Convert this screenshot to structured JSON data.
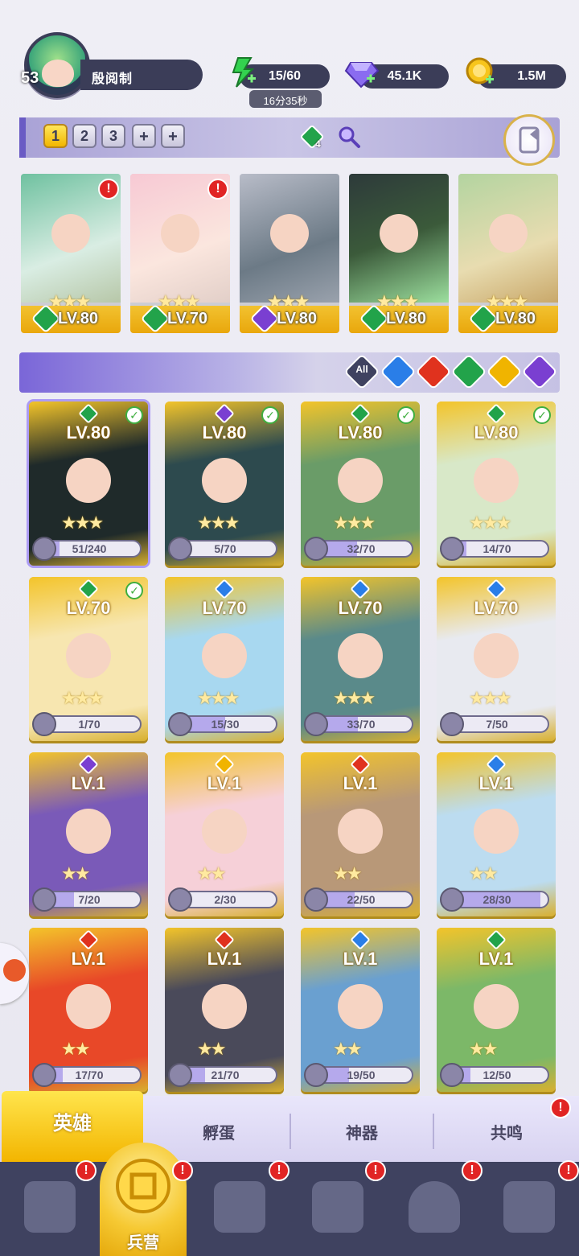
{
  "player": {
    "level": "53",
    "name": "殷阅制"
  },
  "resources": {
    "energy": {
      "value": "15/60",
      "timer": "16分35秒",
      "icon": "lightning-icon"
    },
    "gems": {
      "value": "45.1K",
      "icon": "gem-icon"
    },
    "gold": {
      "value": "1.5M",
      "icon": "coin-icon"
    }
  },
  "team_tabs": [
    "1",
    "2",
    "3",
    "+",
    "+"
  ],
  "team_count": "4",
  "lineup": [
    {
      "level": "LV.80",
      "element": "nature",
      "alert": "!"
    },
    {
      "level": "LV.70",
      "element": "nature",
      "alert": "!"
    },
    {
      "level": "LV.80",
      "element": "shadow",
      "alert": ""
    },
    {
      "level": "LV.80",
      "element": "nature",
      "alert": ""
    },
    {
      "level": "LV.80",
      "element": "nature",
      "alert": ""
    }
  ],
  "filters": [
    "All",
    "water",
    "fire",
    "nature",
    "light",
    "shadow"
  ],
  "heroes": [
    {
      "level": "LV.80",
      "progress": "51/240",
      "fraction": 0.21,
      "element": "nature",
      "checked": true
    },
    {
      "level": "LV.80",
      "progress": "5/70",
      "fraction": 0.07,
      "element": "shadow",
      "checked": true
    },
    {
      "level": "LV.80",
      "progress": "32/70",
      "fraction": 0.46,
      "element": "nature",
      "checked": true
    },
    {
      "level": "LV.80",
      "progress": "14/70",
      "fraction": 0.2,
      "element": "nature",
      "checked": true
    },
    {
      "level": "LV.70",
      "progress": "1/70",
      "fraction": 0.01,
      "element": "nature",
      "checked": true
    },
    {
      "level": "LV.70",
      "progress": "15/30",
      "fraction": 0.5,
      "element": "water",
      "checked": false
    },
    {
      "level": "LV.70",
      "progress": "33/70",
      "fraction": 0.47,
      "element": "water",
      "checked": false
    },
    {
      "level": "LV.70",
      "progress": "7/50",
      "fraction": 0.14,
      "element": "water",
      "checked": false
    },
    {
      "level": "LV.1",
      "progress": "7/20",
      "fraction": 0.35,
      "element": "shadow",
      "checked": false
    },
    {
      "level": "LV.1",
      "progress": "2/30",
      "fraction": 0.07,
      "element": "light",
      "checked": false
    },
    {
      "level": "LV.1",
      "progress": "22/50",
      "fraction": 0.44,
      "element": "fire",
      "checked": false
    },
    {
      "level": "LV.1",
      "progress": "28/30",
      "fraction": 0.93,
      "element": "water",
      "checked": false
    },
    {
      "level": "LV.1",
      "progress": "17/70",
      "fraction": 0.24,
      "element": "fire",
      "checked": false
    },
    {
      "level": "LV.1",
      "progress": "21/70",
      "fraction": 0.3,
      "element": "fire",
      "checked": false
    },
    {
      "level": "LV.1",
      "progress": "19/50",
      "fraction": 0.38,
      "element": "water",
      "checked": false
    },
    {
      "level": "LV.1",
      "progress": "12/50",
      "fraction": 0.24,
      "element": "nature",
      "checked": false
    }
  ],
  "tabs": {
    "heroes": "英雄",
    "hatch": "孵蛋",
    "artifact": "神器",
    "resonance": "共鸣"
  },
  "nav": {
    "barracks": "兵营"
  },
  "colors": {
    "nature": "#22a34a",
    "shadow": "#7a3fd1",
    "water": "#2a7ee8",
    "fire": "#e0321e",
    "light": "#f0b400"
  }
}
